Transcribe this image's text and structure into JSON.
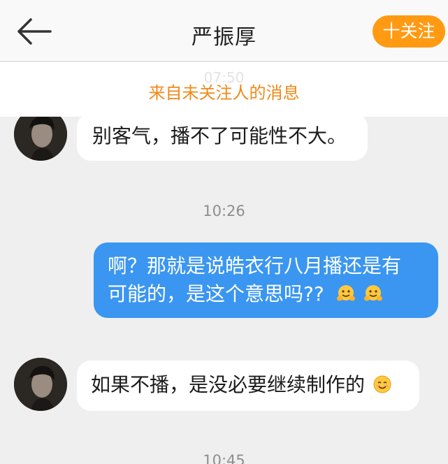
{
  "header": {
    "title": "严振厚",
    "follow_label": "十关注"
  },
  "notice": {
    "faded_time": "07:50",
    "text": "来自未关注人的消息"
  },
  "messages": [
    {
      "from": "other",
      "text": "别客气，播不了可能性不大。"
    },
    {
      "timestamp": "10:26"
    },
    {
      "from": "me",
      "line1": "啊？那就是说皓衣行八月播还是有",
      "line2": "可能的，是这个意思吗??",
      "emoji": "hugging-face"
    },
    {
      "from": "other",
      "text": "如果不播，是没必要继续制作的",
      "emoji": "smiling-face"
    },
    {
      "timestamp": "10:45"
    }
  ],
  "colors": {
    "accent": "#ff9a12",
    "outgoing_bubble": "#3a96f0",
    "notice_text": "#ee8a1a"
  }
}
